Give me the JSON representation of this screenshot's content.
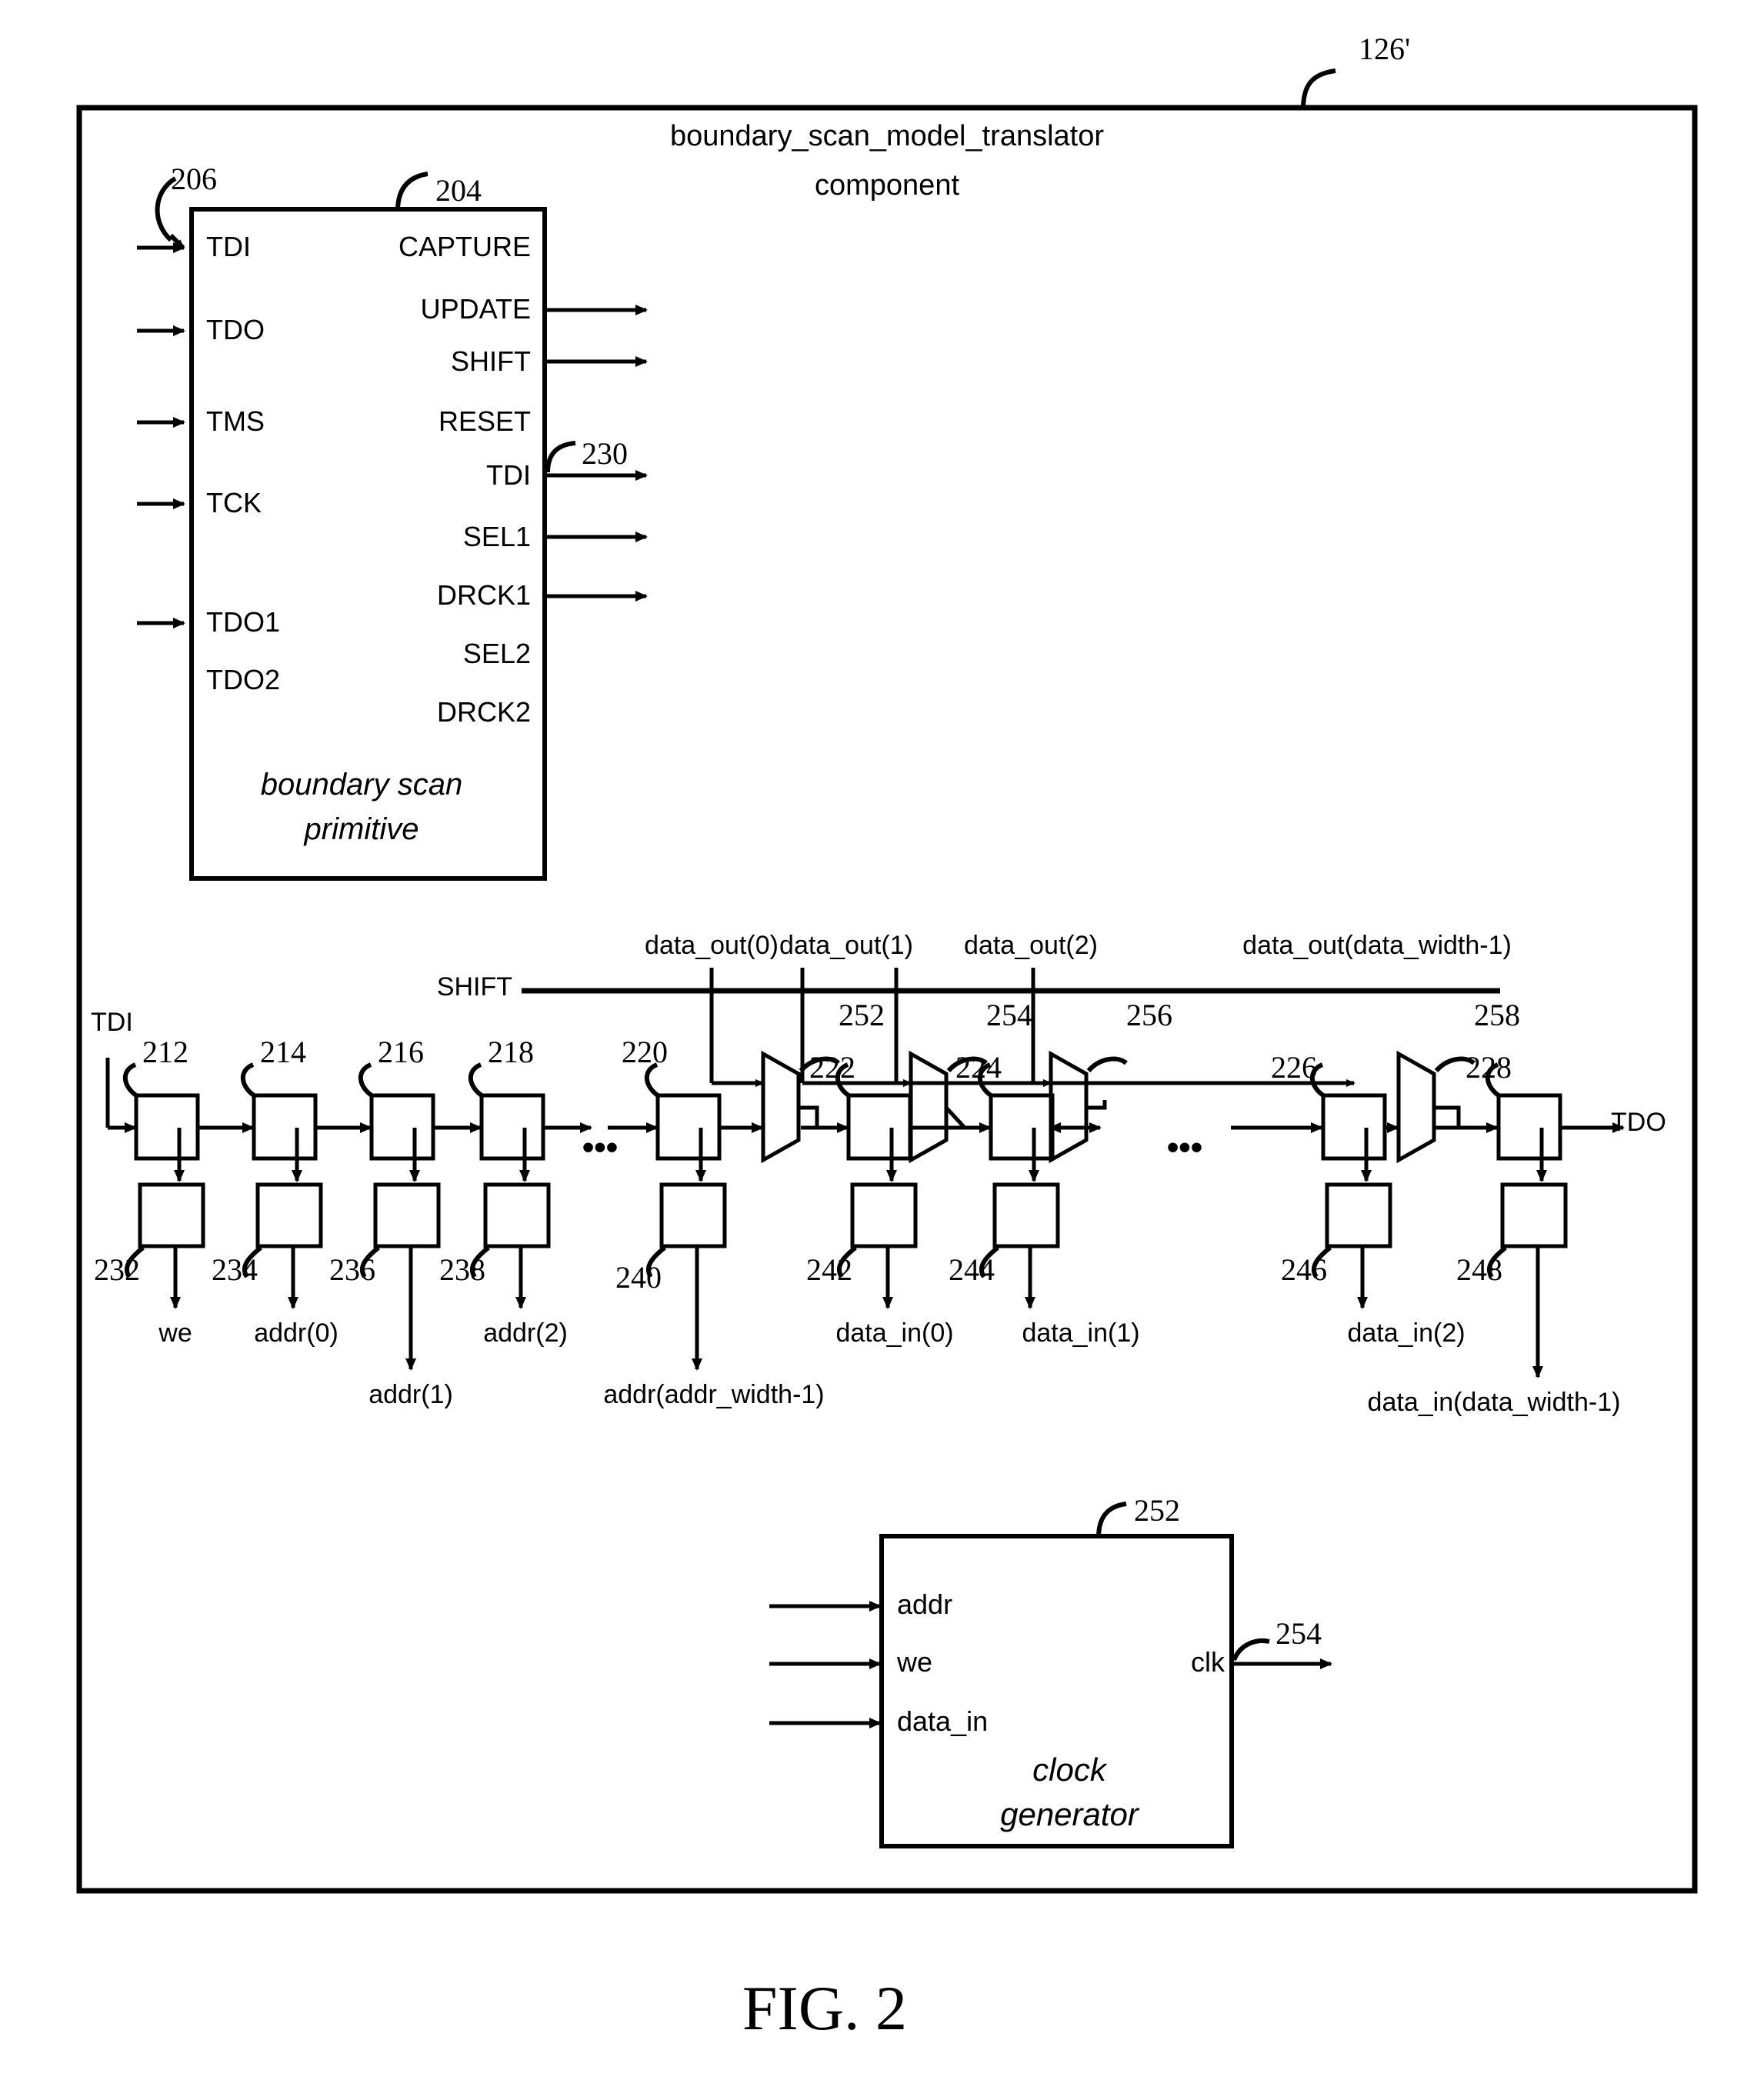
{
  "figure": {
    "caption": "FIG. 2",
    "outer_ref": "126'",
    "title_line1": "boundary_scan_model_translator",
    "title_line2": "component"
  },
  "primitive_block": {
    "ref": "204",
    "input_arrow_ref": "206",
    "caption_line1": "boundary scan",
    "caption_line2": "primitive",
    "left_pins": [
      "TDI",
      "TDO",
      "TMS",
      "TCK",
      "TDO1",
      "TDO2"
    ],
    "right_pins": [
      "CAPTURE",
      "UPDATE",
      "SHIFT",
      "RESET",
      "TDI",
      "SEL1",
      "DRCK1",
      "SEL2",
      "DRCK2"
    ],
    "tdi_out_ref": "230"
  },
  "scan_chain": {
    "input_label": "TDI",
    "output_label": "TDO",
    "shift_label": "SHIFT",
    "ellipsis": "•••",
    "data_out_labels": [
      "data_out(0)",
      "data_out(1)",
      "data_out(2)",
      "data_out(data_width-1)"
    ],
    "cell_refs": [
      "212",
      "214",
      "216",
      "218",
      "220",
      "222",
      "224",
      "226",
      "228"
    ],
    "mux_refs": [
      "252",
      "254",
      "256",
      "258"
    ],
    "latch_refs": [
      "232",
      "234",
      "236",
      "238",
      "240",
      "242",
      "244",
      "246",
      "248"
    ],
    "output_signals": [
      "we",
      "addr(0)",
      "addr(1)",
      "addr(2)",
      "addr(addr_width-1)",
      "data_in(0)",
      "data_in(1)",
      "data_in(2)",
      "data_in(data_width-1)"
    ]
  },
  "clock_generator": {
    "ref": "252",
    "out_ref": "254",
    "inputs": [
      "addr",
      "we",
      "data_in"
    ],
    "output": "clk",
    "caption_line1": "clock",
    "caption_line2": "generator"
  },
  "colors": {
    "ink": "#000000",
    "paper": "#ffffff"
  }
}
